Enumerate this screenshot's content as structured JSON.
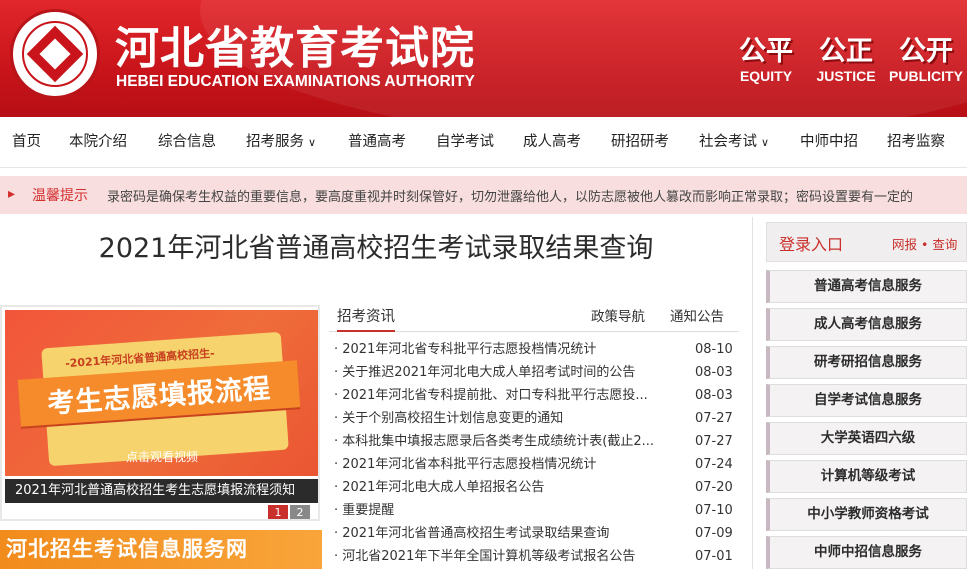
{
  "header": {
    "title": "河北省教育考试院",
    "subtitle": "HEBEI EDUCATION EXAMINATIONS AUTHORITY",
    "mottos": [
      {
        "cn": "公平",
        "en": "EQUITY"
      },
      {
        "cn": "公正",
        "en": "JUSTICE"
      },
      {
        "cn": "公开",
        "en": "PUBLICITY"
      }
    ]
  },
  "nav": {
    "items": [
      {
        "label": "首页"
      },
      {
        "label": "本院介绍"
      },
      {
        "label": "综合信息"
      },
      {
        "label": "招考服务",
        "dropdown": true
      },
      {
        "label": "普通高考"
      },
      {
        "label": "自学考试"
      },
      {
        "label": "成人高考"
      },
      {
        "label": "研招研考"
      },
      {
        "label": "社会考试",
        "dropdown": true
      },
      {
        "label": "中师中招"
      },
      {
        "label": "招考监察"
      }
    ]
  },
  "notice": {
    "label": "温馨提示",
    "text": "录密码是确保考生权益的重要信息，要高度重视并时刻保管好，切勿泄露给他人，以防志愿被他人篡改而影响正常录取；密码设置要有一定的"
  },
  "page_title": "2021年河北省普通高校招生考试录取结果查询",
  "banner": {
    "tag": "-2021年河北省普通高校招生-",
    "headline": "考生志愿填报流程",
    "cta": "点击观看视频",
    "caption": "2021年河北普通高校招生考生志愿填报流程须知",
    "pages": [
      "1",
      "2"
    ]
  },
  "bottom_banner": "河北招生考试信息服务网",
  "news": {
    "tabs": [
      "招考资讯",
      "政策导航",
      "通知公告"
    ],
    "items": [
      {
        "title": "· 2021年河北省专科批平行志愿投档情况统计",
        "date": "08-10"
      },
      {
        "title": "· 关于推迟2021年河北电大成人单招考试时间的公告",
        "date": "08-03"
      },
      {
        "title": "· 2021年河北省专科提前批、对口专科批平行志愿投...",
        "date": "08-03"
      },
      {
        "title": "· 关于个别高校招生计划信息变更的通知",
        "date": "07-27"
      },
      {
        "title": "· 本科批集中填报志愿录后各类考生成绩统计表(截止2...",
        "date": "07-27"
      },
      {
        "title": "· 2021年河北省本科批平行志愿投档情况统计",
        "date": "07-24"
      },
      {
        "title": "· 2021年河北电大成人单招报名公告",
        "date": "07-20"
      },
      {
        "title": "· 重要提醒",
        "date": "07-10"
      },
      {
        "title": "· 2021年河北省普通高校招生考试录取结果查询",
        "date": "07-09"
      },
      {
        "title": "· 河北省2021年下半年全国计算机等级考试报名公告",
        "date": "07-01"
      }
    ]
  },
  "login": {
    "title": "登录入口",
    "links": "网报 • 查询"
  },
  "services": [
    "普通高考信息服务",
    "成人高考信息服务",
    "研考研招信息服务",
    "自学考试信息服务",
    "大学英语四六级",
    "计算机等级考试",
    "中小学教师资格考试",
    "中师中招信息服务"
  ],
  "colors": {
    "brand_red": "#c8141a",
    "notice_bg": "#f8dede",
    "accent_orange": "#f18b1c"
  }
}
